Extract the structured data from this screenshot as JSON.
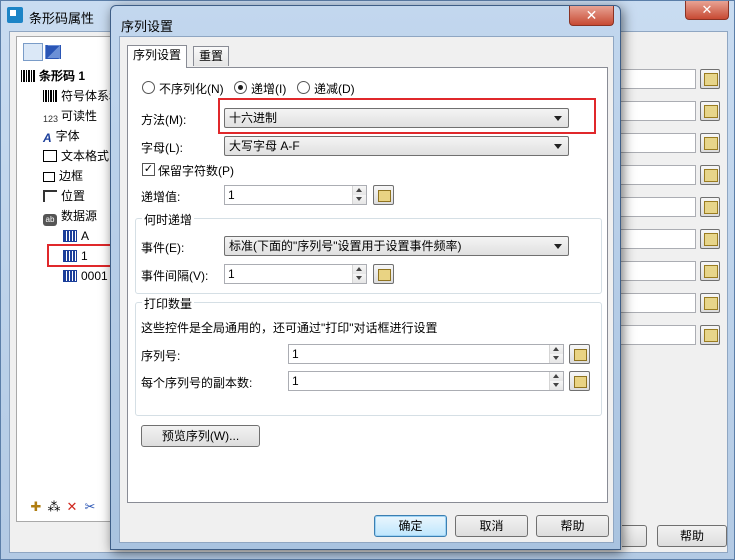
{
  "background_window": {
    "title": "条形码属性",
    "close": "✕",
    "tree": [
      {
        "label": "条形码 1",
        "icon": "barcode-icon"
      },
      {
        "label": "符号体系和",
        "icon": "barcode-icon"
      },
      {
        "label": "可读性",
        "icon": "text-123-icon"
      },
      {
        "label": "字体",
        "icon": "font-icon"
      },
      {
        "label": "文本格式",
        "icon": "text-format-icon"
      },
      {
        "label": "边框",
        "icon": "border-icon"
      },
      {
        "label": "位置",
        "icon": "position-icon"
      },
      {
        "label": "数据源",
        "icon": "datasource-icon"
      },
      {
        "label": "A",
        "icon": "field-icon"
      },
      {
        "label": "1",
        "icon": "field-icon"
      },
      {
        "label": "0001",
        "icon": "field-icon"
      }
    ],
    "help_button": "帮助"
  },
  "dialog": {
    "title": "序列设置",
    "close": "✕",
    "tabs": [
      "序列设置",
      "重置"
    ],
    "mode": {
      "options": [
        "不序列化(N)",
        "递增(I)",
        "递减(D)"
      ],
      "selected": "递增(I)"
    },
    "method_label": "方法(M):",
    "method_value": "十六进制",
    "letter_label": "字母(L):",
    "letter_value": "大写字母 A-F",
    "keep_digits_label": "保留字符数(P)",
    "keep_digits_checked": true,
    "increment_label": "递增值:",
    "increment_value": "1",
    "when_group": {
      "title": "何时递增",
      "event_label": "事件(E):",
      "event_value": "标准(下面的\"序列号\"设置用于设置事件频率)",
      "interval_label": "事件间隔(V):",
      "interval_value": "1"
    },
    "print_group": {
      "title": "打印数量",
      "note": "这些控件是全局通用的，还可通过\"打印\"对话框进行设置",
      "serial_label": "序列号:",
      "serial_value": "1",
      "copies_label": "每个序列号的副本数:",
      "copies_value": "1"
    },
    "preview_button": "预览序列(W)...",
    "ok_button": "确定",
    "cancel_button": "取消",
    "help_button": "帮助"
  },
  "colors": {
    "highlight": "#e0282b",
    "title_bar": "#b3cae4"
  }
}
